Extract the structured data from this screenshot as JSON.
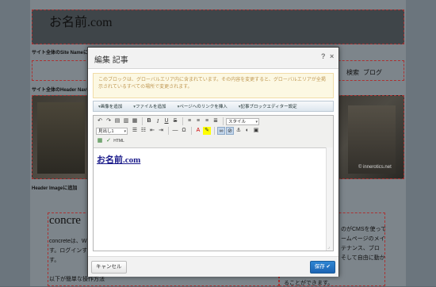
{
  "background": {
    "site_name": "お名前.com",
    "label_site_name": "サイト全体のSite Nameに追",
    "label_header_nav": "サイト全体のHeader Navに追",
    "nav_items": [
      "検索",
      "ブログ"
    ],
    "image_credit": "© innerotics.net",
    "label_header_image": "Header Imageに追加",
    "main_heading": "concre",
    "main_text_1": "concreteは、W",
    "main_text_2": "す。ログインする",
    "main_text_3": "す。",
    "main_text_4": "以下が簡単な操作方法",
    "side_text_1": "のがCMSを使って",
    "side_text_2": "ームページのメイ",
    "side_text_3": "テナンス、ブロ",
    "side_text_4": "そして自由に動か",
    "side_text_5": "ることができます。"
  },
  "dialog": {
    "title": "編集 記事",
    "help_label": "?",
    "close_label": "×",
    "warning": "このブロックは、グローバルエリア内に含まれています。その内容を変更すると、グローバルエリアが全掲示されているすべての場所で変更されます。",
    "block_toolbar": [
      "画像を追加",
      "ファイルを追加",
      "ページへのリンクを挿入",
      "記事ブロックエディター設定"
    ],
    "style_select": "スタイル",
    "format_select": "見出し1",
    "editor_content": "お名前.com",
    "cancel_label": "キャンセル",
    "save_label": "保存 ✔"
  }
}
